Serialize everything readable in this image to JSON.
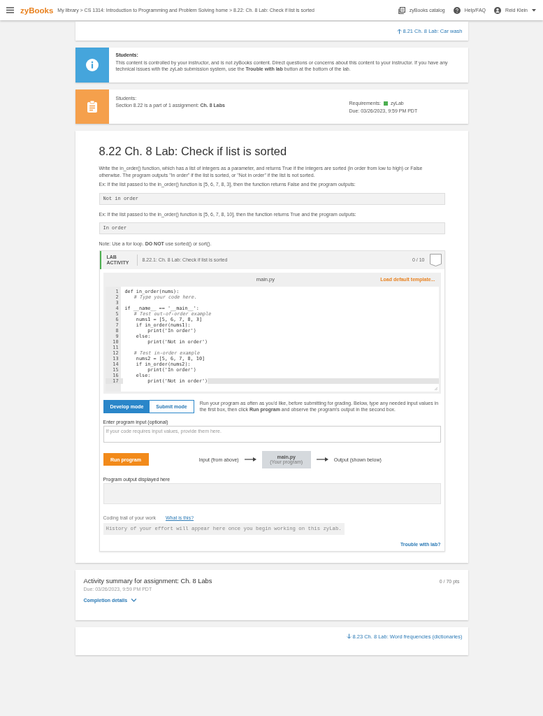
{
  "header": {
    "logo": "zyBooks",
    "breadcrumb": "My library > CS 1314: Introduction to Programming and Problem Solving home > 8.22: Ch. 8 Lab: Check if list is sorted",
    "catalog": "zyBooks catalog",
    "help": "Help/FAQ",
    "user": "Reid Klein"
  },
  "prev_link": "8.21 Ch. 8 Lab: Car wash",
  "notice": {
    "title": "Students:",
    "text": "This content is controlled by your instructor, and is not zyBooks content. Direct questions or concerns about this content to your instructor. If you have any technical issues with the zyLab submission system, use the **Trouble with lab** button at the bottom of the lab."
  },
  "assignment": {
    "title": "Students:",
    "text": "Section 8.22 is a part of 1 assignment: **Ch. 8 Labs**",
    "requirements_label": "Requirements:",
    "requirement": "zyLab",
    "due": "Due: 03/26/2023, 9:59 PM PDT"
  },
  "section": {
    "title": "8.22 Ch. 8 Lab: Check if list is sorted",
    "content": [
      {
        "kind": "text",
        "text": "Write the in_order() function, which has a list of integers as a parameter, and returns True if the integers are sorted (in order from low to high) or False otherwise. The program outputs \"In order\" if the list is sorted, or \"Not in order\" if the list is not sorted."
      },
      {
        "kind": "text",
        "text": "Ex: If the list passed to the in_order() function is [5, 6, 7, 8, 3], then the function returns False and the program outputs:"
      },
      {
        "kind": "output",
        "text": "Not in order"
      },
      {
        "kind": "text",
        "text": "Ex: If the list passed to the in_order() function is [5, 6, 7, 8, 10], then the function returns True and the program outputs:"
      },
      {
        "kind": "output",
        "text": "In order"
      },
      {
        "kind": "text",
        "text": "Note: Use a for loop. **DO NOT** use sorted() or sort()."
      }
    ]
  },
  "lab": {
    "badge": "LAB ACTIVITY",
    "title": "8.22.1: Ch. 8 Lab: Check if list is sorted",
    "score": "0 / 10",
    "filename": "main.py",
    "load_template": "Load default template...",
    "code": [
      {
        "number": "1",
        "kind": "code",
        "text": "def in_order(nums):",
        "current": false
      },
      {
        "number": "2",
        "kind": "comment",
        "text": "    # Type your code here.",
        "current": false
      },
      {
        "number": "3",
        "kind": "blank",
        "current": false
      },
      {
        "number": "4",
        "kind": "code",
        "text": "if __name__ == '__main__':",
        "current": false
      },
      {
        "number": "5",
        "kind": "comment",
        "text": "    # Test out-of-order example",
        "current": false
      },
      {
        "number": "6",
        "kind": "code",
        "text": "    nums1 = [5, 6, 7, 8, 3]",
        "current": false
      },
      {
        "number": "7",
        "kind": "code",
        "text": "    if in_order(nums1):",
        "current": false
      },
      {
        "number": "8",
        "kind": "code",
        "text": "        print('In order')",
        "current": false
      },
      {
        "number": "9",
        "kind": "code",
        "text": "    else:",
        "current": false
      },
      {
        "number": "10",
        "kind": "code",
        "text": "        print('Not in order')",
        "current": false
      },
      {
        "number": "11",
        "kind": "blank",
        "current": false
      },
      {
        "number": "12",
        "kind": "comment",
        "text": "    # Test in-order example",
        "current": false
      },
      {
        "number": "13",
        "kind": "code",
        "text": "    nums2 = [5, 6, 7, 8, 10]",
        "current": false
      },
      {
        "number": "14",
        "kind": "code",
        "text": "    if in_order(nums2):",
        "current": false
      },
      {
        "number": "15",
        "kind": "code",
        "text": "        print('In order')",
        "current": false
      },
      {
        "number": "16",
        "kind": "code",
        "text": "    else:",
        "current": false
      },
      {
        "number": "17",
        "kind": "code",
        "text": "        print('Not in order')",
        "current": true
      }
    ],
    "modes": [
      {
        "label": "Develop mode",
        "selected": true
      },
      {
        "label": "Submit mode",
        "selected": false
      }
    ],
    "mode_help": "Run your program as often as you'd like, before submitting for grading. Below, type any needed input values in the first box, then click **Run program** and observe the program's output in the second box.",
    "input_label": "Enter program input (optional)",
    "input_placeholder": "If your code requires input values, provide them here.",
    "run_button": "Run program",
    "flow_input": "Input (from above)",
    "flow_program": "main.py",
    "flow_program_note": "(Your program)",
    "flow_output": "Output (shown below)",
    "output_label": "Program output displayed here",
    "trail_label": "Coding trail of your work",
    "trail_link": "What is this?",
    "trail_text": "History of your effort will appear here once you begin working on this zyLab.",
    "trouble": "Trouble with lab?"
  },
  "summary": {
    "title": "Activity summary for assignment: Ch. 8 Labs",
    "points": "0 / 70 pts",
    "due": "Due: 03/26/2023, 9:59 PM PDT",
    "details": "Completion details",
    "expanded": false
  },
  "next_link": "8.23 Ch. 8 Lab: Word frequencies (dictionaries)"
}
